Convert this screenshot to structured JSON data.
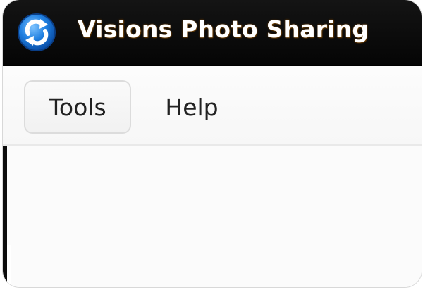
{
  "window": {
    "title": "Visions Photo Sharing",
    "icon": "refresh-arrows-icon",
    "colors": {
      "titlebar": "#0b0b0b",
      "title_text": "#ffffff",
      "title_glow": "#7a4400",
      "icon_blue": "#1a78d6"
    }
  },
  "menubar": {
    "items": [
      {
        "label": "Tools"
      },
      {
        "label": "Help"
      }
    ]
  }
}
